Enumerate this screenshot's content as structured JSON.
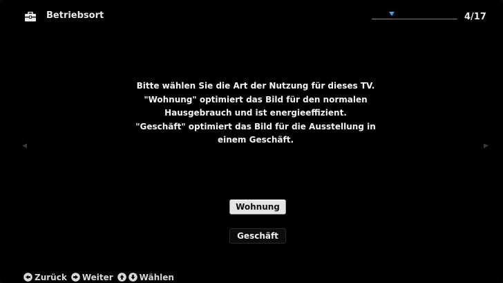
{
  "header": {
    "title": "Betriebsort",
    "icon": "toolbox-icon",
    "page": "4/17",
    "progress": 0.23
  },
  "description": {
    "lines": [
      "Bitte wählen Sie die Art der Nutzung für dieses TV.",
      "\"Wohnung\" optimiert das Bild für den normalen",
      "Hausgebrauch und ist energieeffizient.",
      "\"Geschäft\" optimiert das Bild für die Ausstellung in",
      "einem Geschäft."
    ]
  },
  "options": [
    {
      "label": "Wohnung",
      "selected": true
    },
    {
      "label": "Geschäft",
      "selected": false
    }
  ],
  "footer": {
    "back_label": "Zurück",
    "next_label": "Weiter",
    "select_label": "Wählen"
  },
  "colors": {
    "accent": "#29a8ff",
    "background": "#000000"
  }
}
